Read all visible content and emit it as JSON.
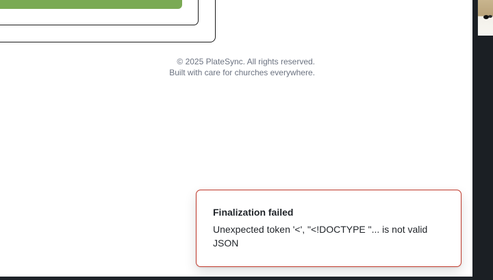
{
  "footer": {
    "copyright": "© 2025 PlateSync. All rights reserved.",
    "tagline": "Built with care for churches everywhere."
  },
  "toast": {
    "title": "Finalization failed",
    "message": "Unexpected token '<', \"<!DOCTYPE \"... is not valid JSON",
    "border_color": "#c0392b"
  },
  "colors": {
    "accent_green": "#7aaa54",
    "page_background": "#ffffff",
    "desktop_background": "#1e2329"
  }
}
